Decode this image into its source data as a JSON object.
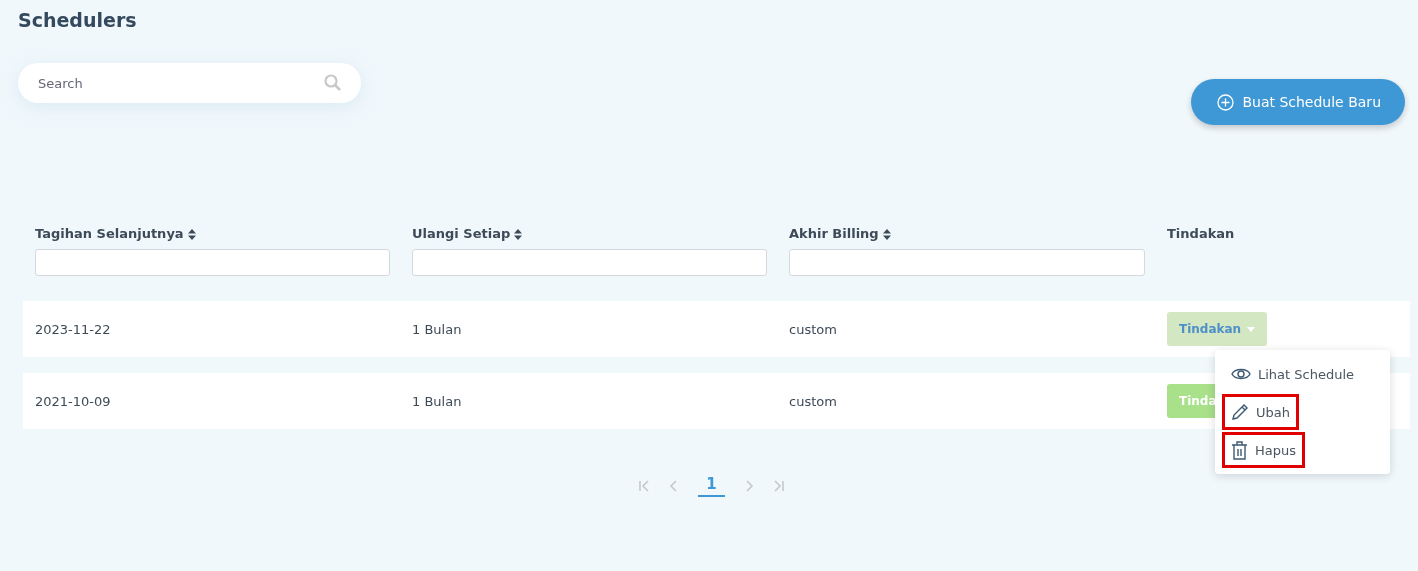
{
  "page_title": "Schedulers",
  "search": {
    "placeholder": "Search"
  },
  "create_button": {
    "label": "Buat Schedule Baru"
  },
  "table": {
    "columns": [
      {
        "label": "Tagihan Selanjutnya",
        "sortable": true,
        "filter": true
      },
      {
        "label": "Ulangi Setiap",
        "sortable": true,
        "filter": true
      },
      {
        "label": "Akhir Billing",
        "sortable": true,
        "filter": true
      },
      {
        "label": "Tindakan",
        "sortable": false,
        "filter": false
      }
    ],
    "rows": [
      {
        "cells": [
          "2023-11-22",
          "1 Bulan",
          "custom"
        ],
        "action": {
          "label": "Tindakan",
          "open": true
        }
      },
      {
        "cells": [
          "2021-10-09",
          "1 Bulan",
          "custom"
        ],
        "action": {
          "label": "Tinda",
          "open": false
        }
      }
    ]
  },
  "action_menu": {
    "items": [
      {
        "kind": "view",
        "label": "Lihat Schedule",
        "highlighted": false
      },
      {
        "kind": "edit",
        "label": "Ubah",
        "highlighted": true
      },
      {
        "kind": "delete",
        "label": "Hapus",
        "highlighted": true
      }
    ]
  },
  "pagination": {
    "pages": [
      {
        "label": "1",
        "selected": true
      }
    ]
  }
}
